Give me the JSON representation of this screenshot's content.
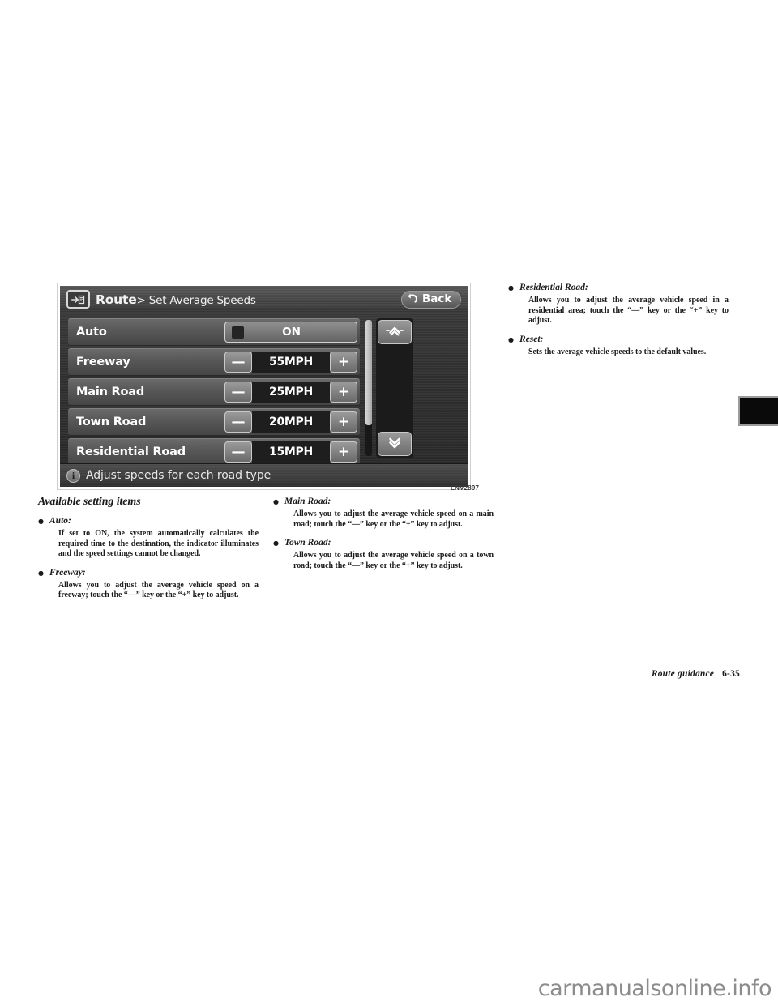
{
  "nav_screen": {
    "header": {
      "icon": "route-map-icon",
      "title": "Route",
      "breadcrumb": "> Set Average Speeds",
      "back_label": "Back",
      "back_icon": "back-arrow-icon"
    },
    "rows": [
      {
        "label": "Auto",
        "control": "toggle",
        "value": "ON",
        "lamp": "off"
      },
      {
        "label": "Freeway",
        "control": "stepper",
        "value": "55MPH",
        "minus": "—",
        "plus": "+"
      },
      {
        "label": "Main Road",
        "control": "stepper",
        "value": "25MPH",
        "minus": "—",
        "plus": "+"
      },
      {
        "label": "Town Road",
        "control": "stepper",
        "value": "20MPH",
        "minus": "—",
        "plus": "+"
      },
      {
        "label": "Residential Road",
        "control": "stepper",
        "value": "15MPH",
        "minus": "—",
        "plus": "+"
      }
    ],
    "scroll": {
      "up_icon": "double-chevron-up-icon",
      "down_icon": "double-chevron-down-icon"
    },
    "info_bar": {
      "icon": "info-icon",
      "icon_glyph": "i",
      "text": "Adjust speeds for each road type"
    },
    "figure_caption": "LNV2897"
  },
  "content": {
    "section_heading": "Available setting items",
    "bullet_glyph": "●",
    "items": [
      {
        "term": "Auto:",
        "body": "If set to ON, the system automatically calculates the required time to the destination, the indicator illuminates and the speed settings cannot be changed."
      },
      {
        "term": "Freeway:",
        "body": "Allows you to adjust the average vehicle speed on a freeway; touch the “—” key or the “+” key to adjust."
      },
      {
        "term": "Main Road:",
        "body": "Allows you to adjust the average vehicle speed on a main road; touch the “—” key or the “+” key to adjust."
      },
      {
        "term": "Town Road:",
        "body": "Allows you to adjust the average vehicle speed on a town road; touch the “—” key or the “+” key to adjust."
      },
      {
        "term": "Residential Road:",
        "body": "Allows you to adjust the average vehicle speed in a residential area; touch the “—” key or the “+” key to adjust."
      },
      {
        "term": "Reset:",
        "body": "Sets the average vehicle speeds to the default values."
      }
    ]
  },
  "footer": {
    "chapter": "Route guidance",
    "page": "6-35"
  },
  "watermark": {
    "text": "carmanualsonline.info"
  }
}
